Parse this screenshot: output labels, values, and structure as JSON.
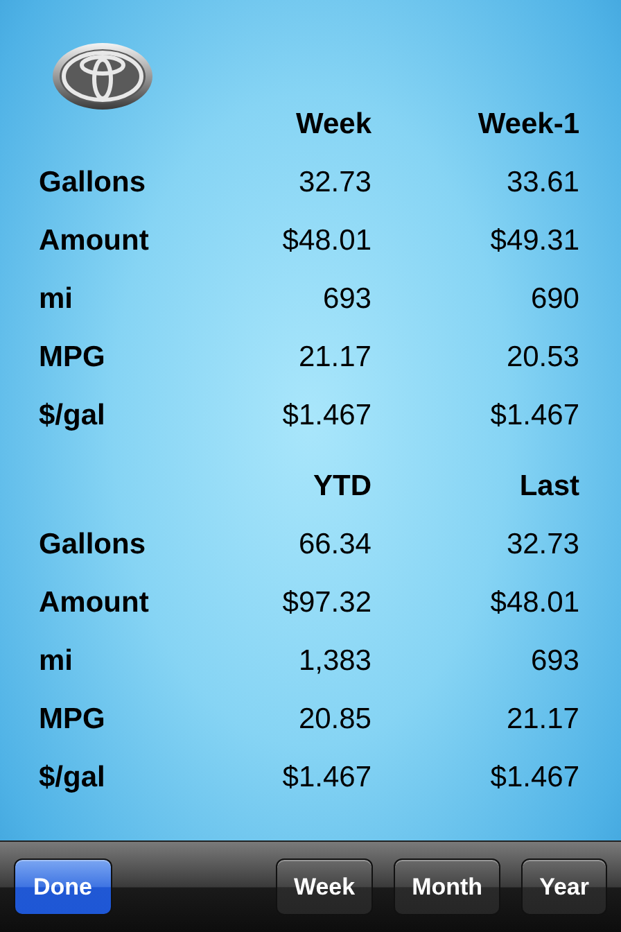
{
  "sections": [
    {
      "columns": [
        "Week",
        "Week-1"
      ],
      "rows": [
        {
          "label": "Gallons",
          "values": [
            "32.73",
            "33.61"
          ]
        },
        {
          "label": "Amount",
          "values": [
            "$48.01",
            "$49.31"
          ]
        },
        {
          "label": "mi",
          "values": [
            "693",
            "690"
          ]
        },
        {
          "label": "MPG",
          "values": [
            "21.17",
            "20.53"
          ]
        },
        {
          "label": "$/gal",
          "values": [
            "$1.467",
            "$1.467"
          ]
        }
      ]
    },
    {
      "columns": [
        "YTD",
        "Last"
      ],
      "rows": [
        {
          "label": "Gallons",
          "values": [
            "66.34",
            "32.73"
          ]
        },
        {
          "label": "Amount",
          "values": [
            "$97.32",
            "$48.01"
          ]
        },
        {
          "label": "mi",
          "values": [
            "1,383",
            "693"
          ]
        },
        {
          "label": "MPG",
          "values": [
            "20.85",
            "21.17"
          ]
        },
        {
          "label": "$/gal",
          "values": [
            "$1.467",
            "$1.467"
          ]
        }
      ]
    }
  ],
  "toolbar": {
    "buttons": [
      {
        "label": "Done",
        "kind": "primary"
      },
      {
        "label": "Week",
        "kind": "plain"
      },
      {
        "label": "Month",
        "kind": "plain"
      },
      {
        "label": "Year",
        "kind": "plain"
      }
    ]
  }
}
